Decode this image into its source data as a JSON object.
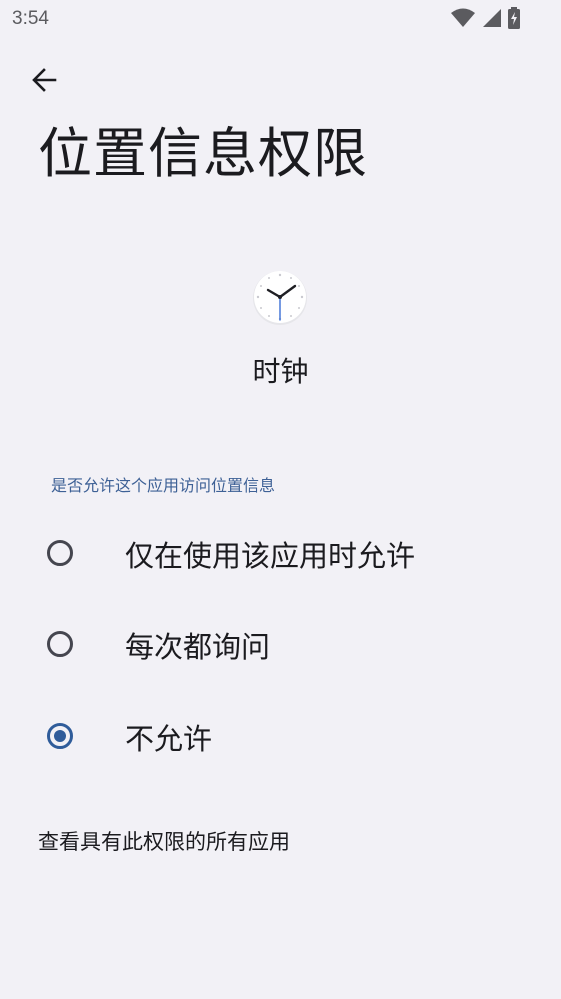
{
  "status_bar": {
    "time": "3:54",
    "icons": [
      "wifi-icon",
      "signal-icon",
      "battery-charging-icon"
    ]
  },
  "header": {
    "back_icon": "arrow-back-icon",
    "title": "位置信息权限"
  },
  "app": {
    "icon": "clock-icon",
    "name": "时钟"
  },
  "permission": {
    "question": "是否允许这个应用访问位置信息",
    "options": [
      {
        "label": "仅在使用该应用时允许",
        "selected": false
      },
      {
        "label": "每次都询问",
        "selected": false
      },
      {
        "label": "不允许",
        "selected": true
      }
    ]
  },
  "footer": {
    "link": "查看具有此权限的所有应用"
  },
  "colors": {
    "background": "#f2f1f6",
    "accent": "#2f5c9a",
    "section_header": "#3e6196",
    "text": "#1b1b1f"
  }
}
